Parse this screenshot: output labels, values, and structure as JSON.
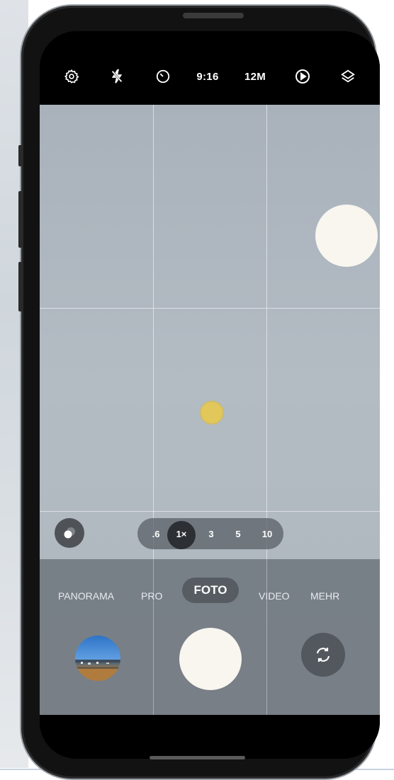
{
  "top_bar": {
    "icons": [
      "settings-gear-icon",
      "flash-off-icon",
      "timer-icon",
      "motion-photo-icon",
      "filters-icon"
    ],
    "aspect_ratio": "9:16",
    "resolution": "12M"
  },
  "zoom": {
    "options": [
      ".6",
      "1×",
      "3",
      "5",
      "10"
    ],
    "active_index": 1
  },
  "modes": {
    "items": [
      "PANORAMA",
      "PRO",
      "FOTO",
      "VIDEO",
      "MEHR"
    ],
    "active": "FOTO"
  },
  "controls": {
    "gallery": "gallery-thumbnail",
    "shutter": "shutter-button",
    "switch": "switch-camera-icon"
  },
  "colors": {
    "accent_focus": "#e2c75a",
    "shutter": "#f8f6ef",
    "topbar": "#000000"
  }
}
